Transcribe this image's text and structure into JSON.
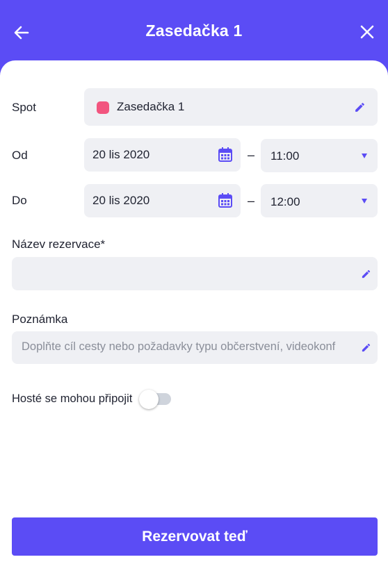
{
  "header": {
    "title": "Zasedačka 1",
    "back_icon": "arrow-left-icon",
    "close_icon": "close-icon"
  },
  "form": {
    "spot": {
      "label": "Spot",
      "value": "Zasedačka 1",
      "color": "#f2557f",
      "edit_icon": "pencil-icon"
    },
    "from": {
      "label": "Od",
      "date": "20 lis 2020",
      "time": "11:00",
      "separator": "–"
    },
    "to": {
      "label": "Do",
      "date": "20 lis 2020",
      "time": "12:00",
      "separator": "–"
    },
    "reservation_name": {
      "label": "Název rezervace*",
      "value": ""
    },
    "note": {
      "label": "Poznámka",
      "placeholder": "Doplňte cíl cesty nebo požadavky typu občerstvení, videokonf"
    },
    "guests": {
      "label": "Hosté se mohou připojit",
      "enabled": false
    }
  },
  "actions": {
    "submit_label": "Rezervovat teď"
  },
  "colors": {
    "accent": "#5b4cf5",
    "field_bg": "#eff0f4",
    "spot_color": "#f2557f"
  }
}
